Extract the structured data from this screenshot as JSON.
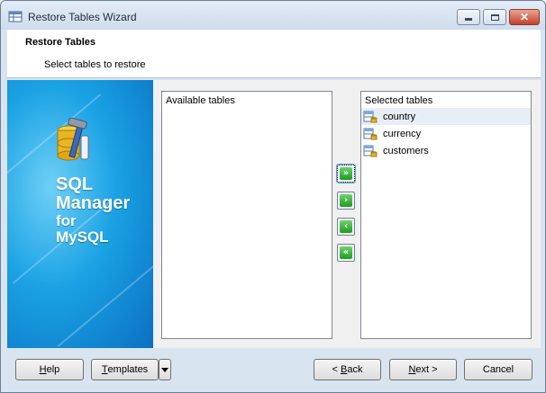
{
  "window": {
    "title": "Restore Tables Wizard"
  },
  "header": {
    "title": "Restore Tables",
    "subtitle": "Select tables to restore"
  },
  "banner": {
    "line1": "SQL",
    "line2": "Manager",
    "line3": "for",
    "line4": "MySQL"
  },
  "available": {
    "header": "Available tables",
    "items": []
  },
  "selected": {
    "header": "Selected tables",
    "items": [
      {
        "label": "country",
        "icon": "table-icon"
      },
      {
        "label": "currency",
        "icon": "table-icon"
      },
      {
        "label": "customers",
        "icon": "table-icon"
      }
    ]
  },
  "move_buttons": {
    "add_all": "»",
    "add": "›",
    "remove": "‹",
    "remove_all": "«"
  },
  "footer": {
    "help_hotkey": "H",
    "help_rest": "elp",
    "templates_hotkey": "T",
    "templates_rest": "emplates",
    "back_prefix": "< ",
    "back_hotkey": "B",
    "back_rest": "ack",
    "next_hotkey": "N",
    "next_rest": "ext >",
    "cancel": "Cancel"
  },
  "colors": {
    "banner": "#1aa2e4",
    "move_button": "#2aa82a",
    "close_button": "#c4412b"
  }
}
